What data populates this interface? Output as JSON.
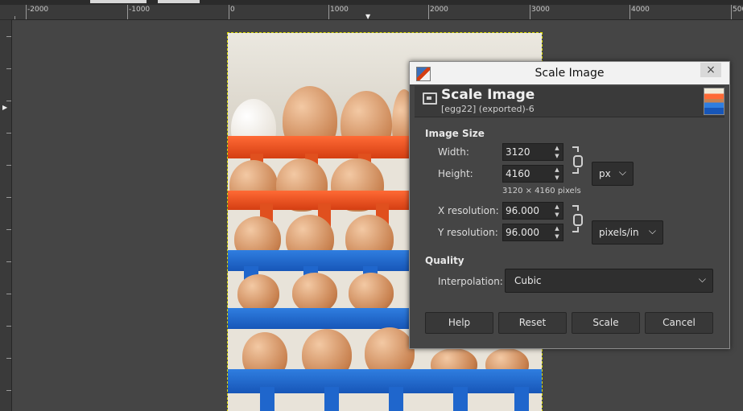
{
  "ruler": {
    "labels": [
      "-2000",
      "-1000",
      "0",
      "1000",
      "2000",
      "3000",
      "4000",
      "5000"
    ]
  },
  "dialog": {
    "title": "Scale Image",
    "close_glyph": "×",
    "header_title": "Scale Image",
    "header_subtitle": "[egg22] (exported)-6",
    "image_size": {
      "section_label": "Image Size",
      "width_label": "Width:",
      "width_value": "3120",
      "height_label": "Height:",
      "height_value": "4160",
      "unit": "px",
      "pixel_info": "3120 × 4160 pixels",
      "xres_label": "X resolution:",
      "xres_value": "96.000",
      "yres_label": "Y resolution:",
      "yres_value": "96.000",
      "res_unit": "pixels/in"
    },
    "quality": {
      "section_label": "Quality",
      "interp_label": "Interpolation:",
      "interp_value": "Cubic"
    },
    "buttons": {
      "help": "Help",
      "reset": "Reset",
      "scale": "Scale",
      "cancel": "Cancel"
    }
  },
  "icons": {
    "dropdown": "chevron-down-icon",
    "chain": "chain-link-icon",
    "spin": "spin-arrows-icon"
  }
}
